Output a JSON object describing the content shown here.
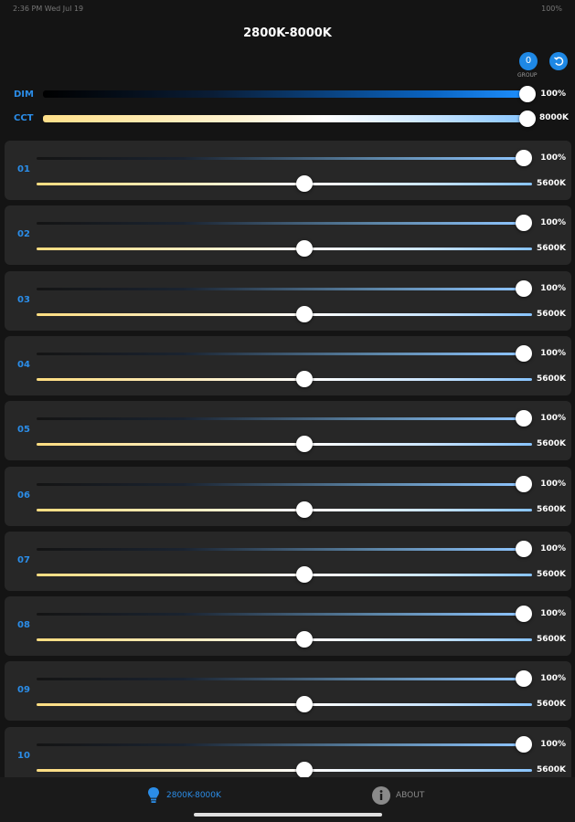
{
  "status": {
    "left": "2:36 PM  Wed Jul 19",
    "right": "100%"
  },
  "title": "2800K-8000K",
  "header": {
    "group_count": "0",
    "group_label": "GROUP"
  },
  "global": {
    "dim": {
      "label": "DIM",
      "value_text": "100%",
      "level": 1.0
    },
    "cct": {
      "label": "CCT",
      "value_text": "8000K",
      "level": 1.0
    }
  },
  "channels": [
    {
      "num": "01",
      "dim_text": "100%",
      "cct_text": "5600K",
      "dim_level": 1.0,
      "cct_level": 0.54
    },
    {
      "num": "02",
      "dim_text": "100%",
      "cct_text": "5600K",
      "dim_level": 1.0,
      "cct_level": 0.54
    },
    {
      "num": "03",
      "dim_text": "100%",
      "cct_text": "5600K",
      "dim_level": 1.0,
      "cct_level": 0.54
    },
    {
      "num": "04",
      "dim_text": "100%",
      "cct_text": "5600K",
      "dim_level": 1.0,
      "cct_level": 0.54
    },
    {
      "num": "05",
      "dim_text": "100%",
      "cct_text": "5600K",
      "dim_level": 1.0,
      "cct_level": 0.54
    },
    {
      "num": "06",
      "dim_text": "100%",
      "cct_text": "5600K",
      "dim_level": 1.0,
      "cct_level": 0.54
    },
    {
      "num": "07",
      "dim_text": "100%",
      "cct_text": "5600K",
      "dim_level": 1.0,
      "cct_level": 0.54
    },
    {
      "num": "08",
      "dim_text": "100%",
      "cct_text": "5600K",
      "dim_level": 1.0,
      "cct_level": 0.54
    },
    {
      "num": "09",
      "dim_text": "100%",
      "cct_text": "5600K",
      "dim_level": 1.0,
      "cct_level": 0.54
    },
    {
      "num": "10",
      "dim_text": "100%",
      "cct_text": "5600K",
      "dim_level": 1.0,
      "cct_level": 0.54
    }
  ],
  "tabs": [
    {
      "label": "2800K-8000K",
      "icon": "lightbulb-icon",
      "active": true
    },
    {
      "label": "ABOUT",
      "icon": "info-icon",
      "active": false
    }
  ],
  "colors": {
    "accent": "#2b8de8",
    "background": "#141414",
    "panel": "#272727",
    "inactive_tab": "#8a8a8a"
  }
}
